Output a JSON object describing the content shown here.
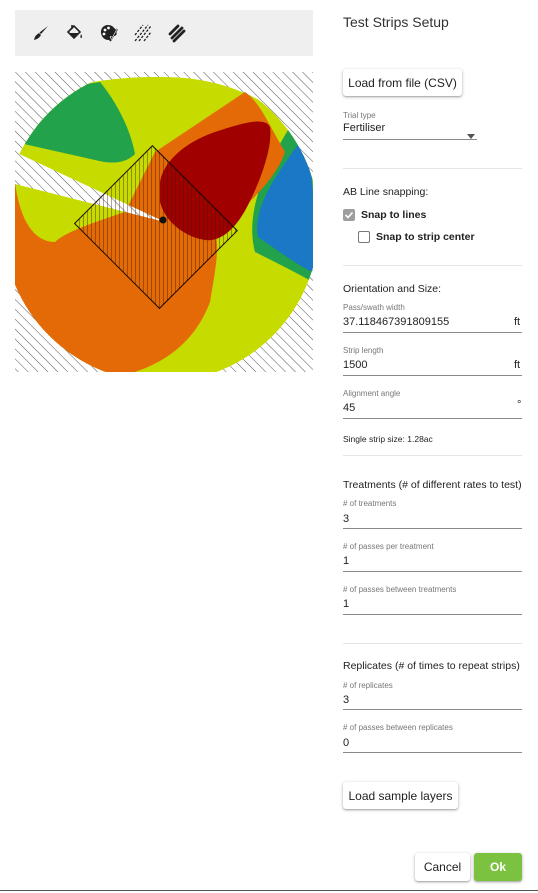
{
  "toolbar": {
    "tools": [
      {
        "name": "brush-icon"
      },
      {
        "name": "paint-bucket-icon"
      },
      {
        "name": "palette-icon"
      },
      {
        "name": "hatch-light-icon"
      },
      {
        "name": "hatch-heavy-icon"
      }
    ]
  },
  "map": {
    "colors": {
      "background_hatch": "#555555",
      "lime": "#c6db00",
      "green": "#22a24a",
      "orange": "#e46a07",
      "dark_red": "#a00000",
      "blue": "#1b78c6",
      "white_gap": "#ffffff"
    }
  },
  "panel": {
    "title": "Test Strips Setup",
    "load_csv_label": "Load from file (CSV)",
    "trial_type": {
      "label": "Trial type",
      "value": "Fertiliser"
    },
    "ab_line": {
      "heading": "AB Line snapping:",
      "snap_lines_label": "Snap to lines",
      "snap_lines_checked": true,
      "snap_center_label": "Snap to strip center",
      "snap_center_checked": false
    },
    "orientation": {
      "heading": "Orientation and Size:",
      "swath_label": "Pass/swath width",
      "swath_value": "37.118467391809155",
      "swath_unit": "ft",
      "length_label": "Strip length",
      "length_value": "1500",
      "length_unit": "ft",
      "angle_label": "Alignment angle",
      "angle_value": "45",
      "angle_unit": "°",
      "strip_size": "Single strip size: 1.28ac"
    },
    "treatments": {
      "heading": "Treatments (# of different rates to test)",
      "count_label": "# of treatments",
      "count_value": "3",
      "passes_per_label": "# of passes per treatment",
      "passes_per_value": "1",
      "passes_between_label": "# of passes between treatments",
      "passes_between_value": "1"
    },
    "replicates": {
      "heading": "Replicates (# of times to repeat strips)",
      "count_label": "# of replicates",
      "count_value": "3",
      "passes_between_label": "# of passes between replicates",
      "passes_between_value": "0"
    },
    "load_sample_label": "Load sample layers",
    "cancel_label": "Cancel",
    "ok_label": "Ok",
    "accent_color": "#7cc241"
  }
}
